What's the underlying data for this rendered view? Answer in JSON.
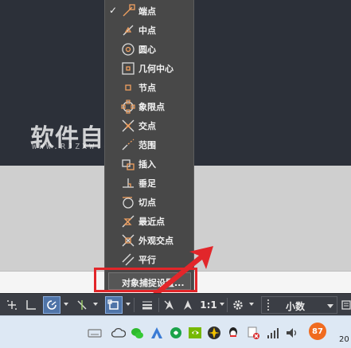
{
  "watermark": {
    "title": "软件自学网",
    "url": "WWW.RJZXW.COM"
  },
  "osnap_menu": {
    "items": [
      {
        "label": "端点",
        "icon": "endpoint-icon",
        "checked": true
      },
      {
        "label": "中点",
        "icon": "midpoint-icon",
        "checked": false
      },
      {
        "label": "圆心",
        "icon": "center-icon",
        "checked": false
      },
      {
        "label": "几何中心",
        "icon": "geometric-center-icon",
        "checked": false
      },
      {
        "label": "节点",
        "icon": "node-icon",
        "checked": false
      },
      {
        "label": "象限点",
        "icon": "quadrant-icon",
        "checked": false
      },
      {
        "label": "交点",
        "icon": "intersection-icon",
        "checked": false
      },
      {
        "label": "范围",
        "icon": "extension-icon",
        "checked": false
      },
      {
        "label": "插入",
        "icon": "insertion-icon",
        "checked": false
      },
      {
        "label": "垂足",
        "icon": "perpendicular-icon",
        "checked": false
      },
      {
        "label": "切点",
        "icon": "tangent-icon",
        "checked": false
      },
      {
        "label": "最近点",
        "icon": "nearest-icon",
        "checked": false
      },
      {
        "label": "外观交点",
        "icon": "apparent-intersection-icon",
        "checked": false
      },
      {
        "label": "平行",
        "icon": "parallel-icon",
        "checked": false
      }
    ],
    "check_mark": "✓",
    "settings_label": "对象捕捉设置..."
  },
  "statusbar": {
    "scale": "1:1",
    "units": "小数"
  },
  "taskbar": {
    "notification_badge": "87",
    "clock_partial": "20"
  },
  "colors": {
    "accent_snap": "#f0a060",
    "active_button": "#4f74a8",
    "annotation_red": "#e2262a"
  }
}
